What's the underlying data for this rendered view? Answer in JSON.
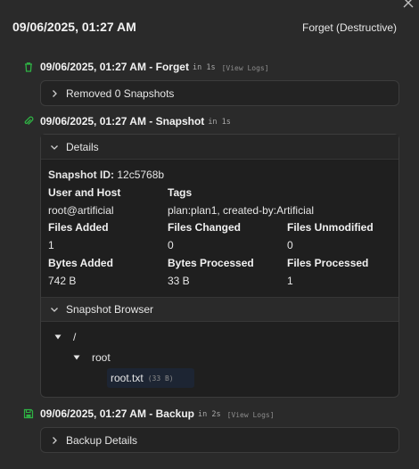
{
  "header": {
    "title": "09/06/2025, 01:27 AM",
    "right_label": "Forget (Destructive)",
    "close_icon": "close-icon"
  },
  "operations": [
    {
      "title": "09/06/2025, 01:27 AM - Forget",
      "duration": "in 1s",
      "logs": "[View Logs]",
      "icon": "trash-icon",
      "panel_label": "Removed 0 Snapshots"
    },
    {
      "title": "09/06/2025, 01:27 AM - Snapshot",
      "duration": "in 1s",
      "icon": "paperclip-icon",
      "panel_label": "Details",
      "details": {
        "snapshot_id_label": "Snapshot ID:",
        "snapshot_id": "12c5768b",
        "user_host_label": "User and Host",
        "user_host": "root@artificial",
        "tags_label": "Tags",
        "tags": "plan:plan1, created-by:Artificial",
        "files_added_label": "Files Added",
        "files_added": "1",
        "files_changed_label": "Files Changed",
        "files_changed": "0",
        "files_unmodified_label": "Files Unmodified",
        "files_unmodified": "0",
        "bytes_added_label": "Bytes Added",
        "bytes_added": "742 B",
        "bytes_processed_label": "Bytes Processed",
        "bytes_processed": "33 B",
        "files_processed_label": "Files Processed",
        "files_processed": "1"
      },
      "browser": {
        "label": "Snapshot Browser",
        "root": "/",
        "folder": "root",
        "file": "root.txt",
        "file_size": "(33 B)"
      }
    },
    {
      "title": "09/06/2025, 01:27 AM - Backup",
      "duration": "in 2s",
      "logs": "[View Logs]",
      "icon": "save-icon",
      "panel_label": "Backup Details"
    }
  ],
  "colors": {
    "accent_green": "#2fb344",
    "background": "#2a2a2a",
    "panel": "#232323"
  }
}
